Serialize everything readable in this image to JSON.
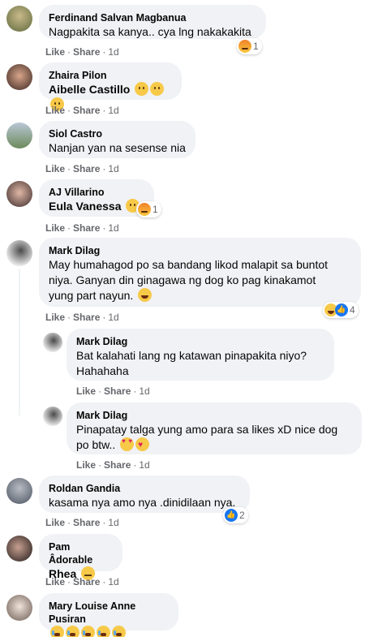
{
  "actions": {
    "like": "Like",
    "share": "Share",
    "sep": "·"
  },
  "comments": [
    {
      "name": "Ferdinand Salvan Magbanua",
      "text": "Nagpakita sa kanya.. cya lng nakakakita",
      "time": "1d",
      "reaction_count": "1",
      "reactions": [
        "angry"
      ]
    },
    {
      "name": "Zhaira Pilon",
      "text": "Aibelle Castillo",
      "time": "1d",
      "emojis": [
        "sad",
        "sad",
        "sad"
      ]
    },
    {
      "name": "Siol Castro",
      "text": "Nanjan yan na sesense nia",
      "time": "1d"
    },
    {
      "name": "AJ Villarino",
      "text": "Eula Vanessa",
      "time": "1d",
      "reaction_count": "1",
      "emojis": [
        "sad"
      ],
      "reactions": [
        "angry"
      ]
    },
    {
      "name": "Mark Dilag",
      "line1": "May humahagod po sa bandang likod malapit sa buntot",
      "line2": "niya. Ganyan din ginagawa ng dog ko pag kinakamot",
      "line3": "yung part nayun.",
      "time": "1d",
      "reaction_count": "4",
      "emojis": [
        "laugh"
      ],
      "reactions": [
        "laugh",
        "like"
      ],
      "replies": [
        {
          "name": "Mark Dilag",
          "line1": "Bat kalahati lang ng katawan pinapakita niyo?",
          "line2": "Hahahaha",
          "time": "1d"
        },
        {
          "name": "Mark Dilag",
          "line1": "Pinapatay talga yung amo para sa likes xD nice dog",
          "line2": "po btw..",
          "time": "1d",
          "emojis": [
            "love",
            "hugs"
          ]
        }
      ]
    },
    {
      "name": "Roldan Gandia",
      "text": "kasama nya amo nya .dinidilaan nya.",
      "time": "1d",
      "reaction_count": "2",
      "reactions": [
        "like"
      ]
    },
    {
      "name": "Pam Âdorable",
      "text": "Rhea",
      "time": "1d",
      "emojis": [
        "meh"
      ]
    },
    {
      "name": "Mary Louise Anne Pusiran",
      "emojis": [
        "cry",
        "cry",
        "cry",
        "cry",
        "cry"
      ]
    }
  ],
  "colors": {
    "bubble": "#f0f2f5",
    "meta": "#65676b",
    "like_blue": "#1877f2",
    "text": "#050505"
  }
}
